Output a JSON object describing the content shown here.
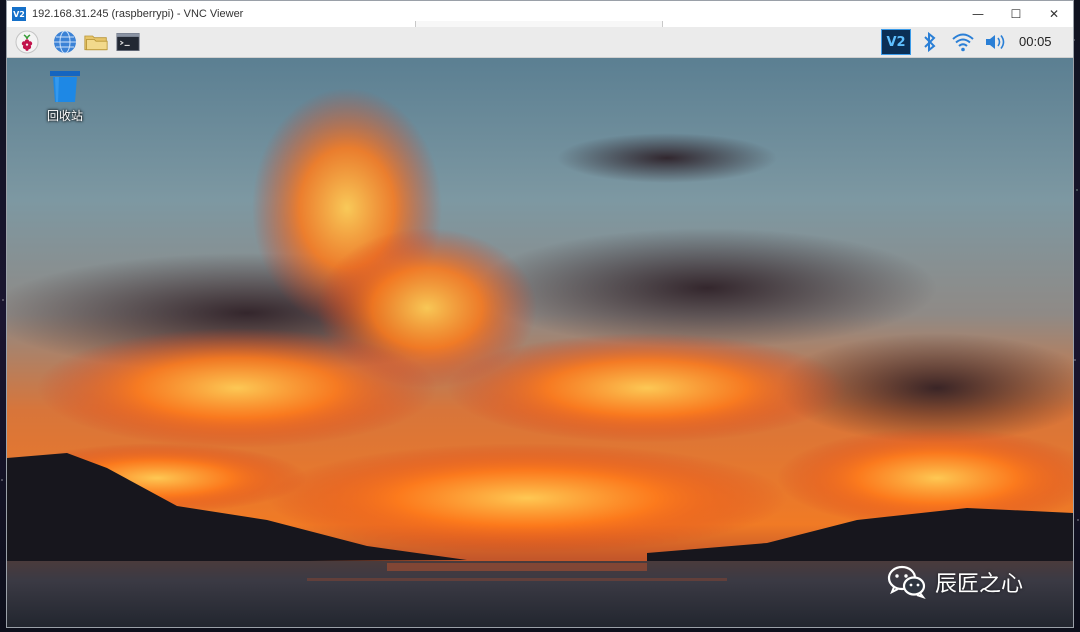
{
  "window": {
    "title": "192.168.31.245 (raspberrypi) - VNC Viewer",
    "app_icon_text": "V2",
    "controls": {
      "minimize": "—",
      "maximize": "☐",
      "close": "✕"
    }
  },
  "taskbar": {
    "launchers": [
      {
        "icon": "raspberry-menu-icon"
      },
      {
        "icon": "web-browser-globe-icon"
      },
      {
        "icon": "file-manager-folder-icon"
      },
      {
        "icon": "terminal-icon"
      }
    ],
    "tray": {
      "vnc_text": "V2",
      "bluetooth_icon": "bluetooth-icon",
      "wifi_icon": "wifi-icon",
      "volume_icon": "volume-icon",
      "clock": "00:05"
    }
  },
  "desktop": {
    "icons": [
      {
        "label": "回收站",
        "icon": "trash-bin-icon"
      }
    ]
  },
  "watermark": {
    "text": "辰匠之心",
    "icon": "wechat-icon"
  },
  "colors": {
    "accent": "#1570c9",
    "trash_blue": "#1e88e5",
    "sky_top": "#5f8394",
    "sunset_orange": "#f06a1c",
    "water": "#2e3540"
  }
}
